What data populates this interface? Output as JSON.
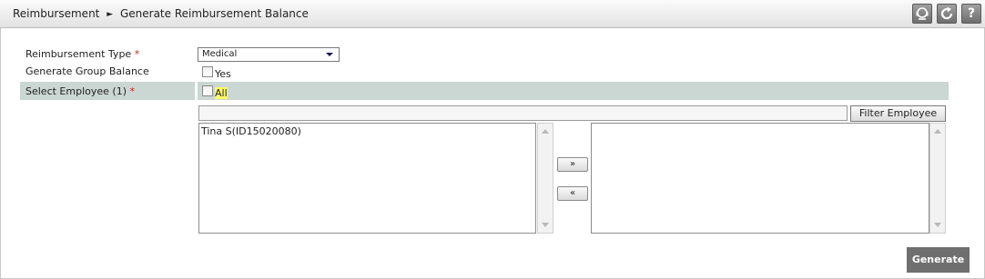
{
  "header": {
    "breadcrumb_parent": "Reimbursement",
    "breadcrumb_separator": "►",
    "breadcrumb_current": "Generate Reimbursement Balance",
    "icons": [
      "support-icon",
      "refresh-icon",
      "help-icon"
    ],
    "help_glyph": "?"
  },
  "form": {
    "type_label": "Reimbursement Type",
    "type_value": "Medical",
    "group_label": "Generate Group Balance",
    "group_option": "Yes",
    "select_label": "Select Employee (1)",
    "all_option": "All",
    "required_mark": "*",
    "filter_value": "",
    "filter_button": "Filter Employee"
  },
  "available_list": [
    "Tina S(ID15020080)"
  ],
  "selected_list": [],
  "buttons": {
    "add": "»",
    "remove": "«",
    "generate": "Generate"
  },
  "colors": {
    "band": "#cbd7d3",
    "generate_bg": "#6f6f6f",
    "required": "#d02020",
    "highlight": "#fffa6a"
  }
}
